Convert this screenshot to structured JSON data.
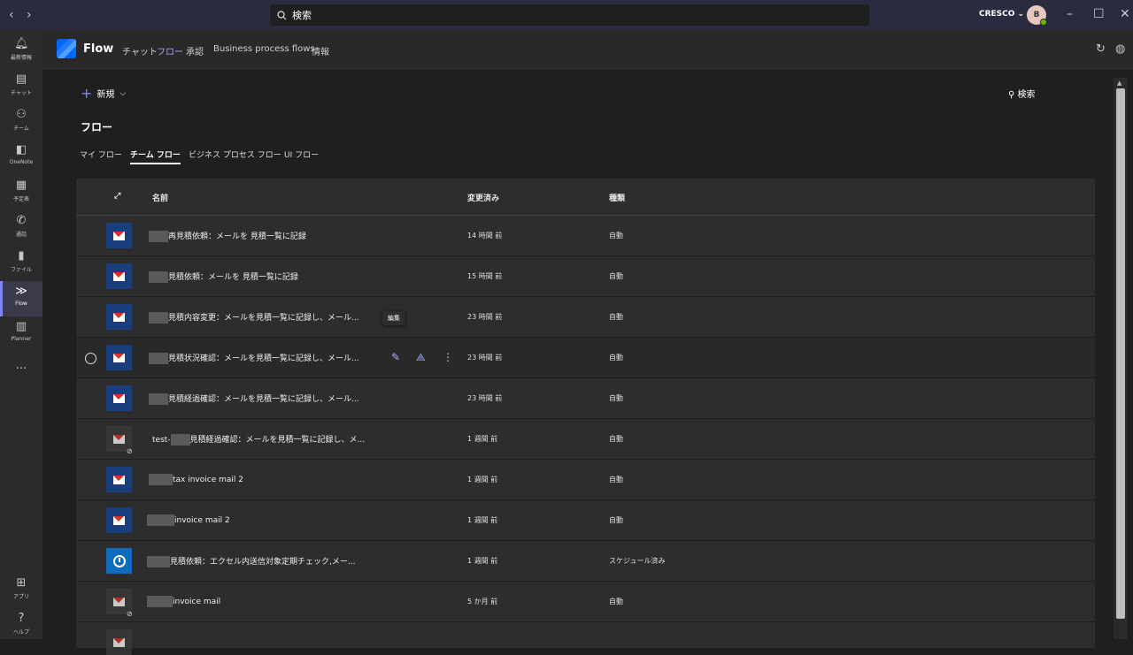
{
  "titlebar": {
    "search_placeholder": "検索",
    "org": "CRESCO ⌄",
    "avatar_initials": "B"
  },
  "rail": [
    {
      "label": "最新情報",
      "icon": "bell-icon"
    },
    {
      "label": "チャット",
      "icon": "chat-icon"
    },
    {
      "label": "チーム",
      "icon": "teams-icon"
    },
    {
      "label": "OneNote",
      "icon": "onenote-icon"
    },
    {
      "label": "予定表",
      "icon": "calendar-icon"
    },
    {
      "label": "通話",
      "icon": "phone-icon"
    },
    {
      "label": "ファイル",
      "icon": "file-icon"
    },
    {
      "label": "Flow",
      "icon": "flow-icon"
    },
    {
      "label": "Planner",
      "icon": "planner-icon"
    },
    {
      "label": "...",
      "icon": "more-icon"
    },
    {
      "label": "アプリ",
      "icon": "apps-icon"
    },
    {
      "label": "ヘルプ",
      "icon": "help-icon"
    }
  ],
  "app": {
    "name": "Flow",
    "tabs": [
      "チャット",
      "フロー",
      "承認",
      "Business process flows",
      "情報"
    ],
    "active_tab": "フロー"
  },
  "toolbar": {
    "new_label": "新規",
    "search_label": "検索"
  },
  "page": {
    "title": "フロー",
    "subtabs": [
      "マイ フロー",
      "チーム フロー",
      "ビジネス プロセス フロー",
      "UI フロー"
    ]
  },
  "table": {
    "headers": {
      "name": "名前",
      "modified": "変更済み",
      "type": "種類"
    },
    "tooltip": "編集",
    "rows": [
      {
        "name": "再見積依頼：メールを 見積一覧に記録",
        "modified": "14 時間 前",
        "type": "自動",
        "icon": "gmail-icon"
      },
      {
        "name": "見積依頼：メールを 見積一覧に記録",
        "modified": "15 時間 前",
        "type": "自動",
        "icon": "gmail-icon"
      },
      {
        "name": "見積内容変更：メールを見積一覧に記録し、メール...",
        "modified": "23 時間 前",
        "type": "自動",
        "icon": "gmail-icon"
      },
      {
        "name": "見積状況確認：メールを見積一覧に記録し、メール...",
        "modified": "23 時間 前",
        "type": "自動",
        "icon": "gmail-icon"
      },
      {
        "name": "見積経過確認：メールを見積一覧に記録し、メール...",
        "modified": "23 時間 前",
        "type": "自動",
        "icon": "gmail-icon"
      },
      {
        "name": "test-",
        "name2": "見積経過確認：メールを見積一覧に記録し、メ...",
        "modified": "1 週間 前",
        "type": "自動",
        "icon": "gmail-icon"
      },
      {
        "name": "tax invoice mail 2",
        "modified": "1 週間 前",
        "type": "自動",
        "icon": "gmail-icon"
      },
      {
        "name": "invoice mail 2",
        "modified": "1 週間 前",
        "type": "自動",
        "icon": "gmail-icon"
      },
      {
        "name": "見積依頼：エクセル内送信対象定期チェック,メー...",
        "modified": "1 週間 前",
        "type": "スケジュール済み",
        "icon": "timer-icon"
      },
      {
        "name": "invoice mail",
        "modified": "5 か月 前",
        "type": "自動",
        "icon": "gmail-icon"
      }
    ]
  }
}
